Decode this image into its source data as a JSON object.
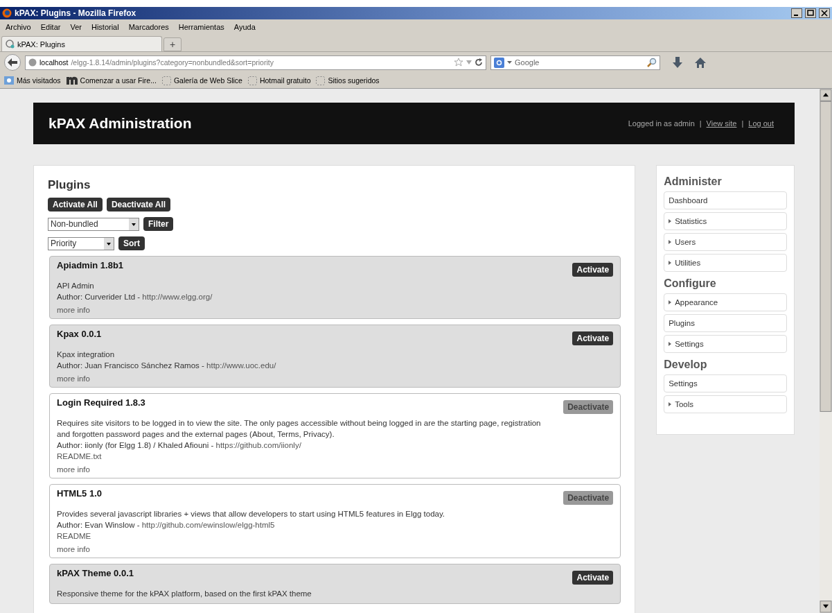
{
  "window": {
    "title": "kPAX: Plugins - Mozilla Firefox"
  },
  "menu": [
    "Archivo",
    "Editar",
    "Ver",
    "Historial",
    "Marcadores",
    "Herramientas",
    "Ayuda"
  ],
  "tabs": [
    {
      "label": "kPAX: Plugins",
      "selected": true
    }
  ],
  "new_tab": "+",
  "address": {
    "host": "localhost",
    "path": "/elgg-1.8.14/admin/plugins?category=nonbundled&sort=priority"
  },
  "search": {
    "placeholder": "Google"
  },
  "bookmarks": [
    {
      "label": "Más visitados",
      "kind": "folder"
    },
    {
      "label": "Comenzar a usar Fire...",
      "kind": "m"
    },
    {
      "label": "Galería de Web Slice",
      "kind": "slice"
    },
    {
      "label": "Hotmail gratuito",
      "kind": "slice"
    },
    {
      "label": "Sitios sugeridos",
      "kind": "slice"
    }
  ],
  "header": {
    "title": "kPAX Administration",
    "logged_in": "Logged in as admin",
    "separator": "|",
    "links": [
      "View site",
      "Log out"
    ]
  },
  "main": {
    "heading": "Plugins",
    "bulk_buttons": [
      "Activate All",
      "Deactivate All"
    ],
    "filter": {
      "value": "Non-bundled",
      "button": "Filter"
    },
    "sort": {
      "value": "Priority",
      "button": "Sort"
    },
    "plugins": [
      {
        "title": "Apiadmin 1.8b1",
        "active": false,
        "action": "Activate",
        "description": "API Admin",
        "author": "Author: Curverider Ltd - ",
        "author_link": "http://www.elgg.org/",
        "more": "more info"
      },
      {
        "title": "Kpax 0.0.1",
        "active": false,
        "action": "Activate",
        "description": "Kpax integration",
        "author": "Author: Juan Francisco Sánchez Ramos - ",
        "author_link": "http://www.uoc.edu/",
        "more": "more info"
      },
      {
        "title": "Login Required 1.8.3",
        "active": true,
        "action": "Deactivate",
        "description": "Requires site visitors to be logged in to view the site. The only pages accessible without being logged in are the starting page, registration and forgotten password pages and the external pages (About, Terms, Privacy).",
        "author": "Author: iionly (for Elgg 1.8) / Khaled Afiouni - ",
        "author_link": "https://github.com/iionly/",
        "readme": "README.txt",
        "more": "more info"
      },
      {
        "title": "HTML5 1.0",
        "active": true,
        "action": "Deactivate",
        "description": "Provides several javascript libraries + views that allow developers to start using HTML5 features in Elgg today.",
        "author": "Author: Evan Winslow - ",
        "author_link": "http://github.com/ewinslow/elgg-html5",
        "readme": "README",
        "more": "more info"
      },
      {
        "title": "kPAX Theme 0.0.1",
        "active": false,
        "action": "Activate",
        "description": "Responsive theme for the kPAX platform, based on the first kPAX theme"
      }
    ]
  },
  "sidebar": [
    {
      "heading": "Administer",
      "items": [
        {
          "label": "Dashboard",
          "kind": "link"
        },
        {
          "label": "Statistics",
          "kind": "toggle"
        },
        {
          "label": "Users",
          "kind": "toggle"
        },
        {
          "label": "Utilities",
          "kind": "toggle"
        }
      ]
    },
    {
      "heading": "Configure",
      "items": [
        {
          "label": "Appearance",
          "kind": "toggle"
        },
        {
          "label": "Plugins",
          "kind": "link"
        },
        {
          "label": "Settings",
          "kind": "toggle"
        }
      ]
    },
    {
      "heading": "Develop",
      "items": [
        {
          "label": "Settings",
          "kind": "link"
        },
        {
          "label": "Tools",
          "kind": "toggle"
        }
      ]
    }
  ]
}
